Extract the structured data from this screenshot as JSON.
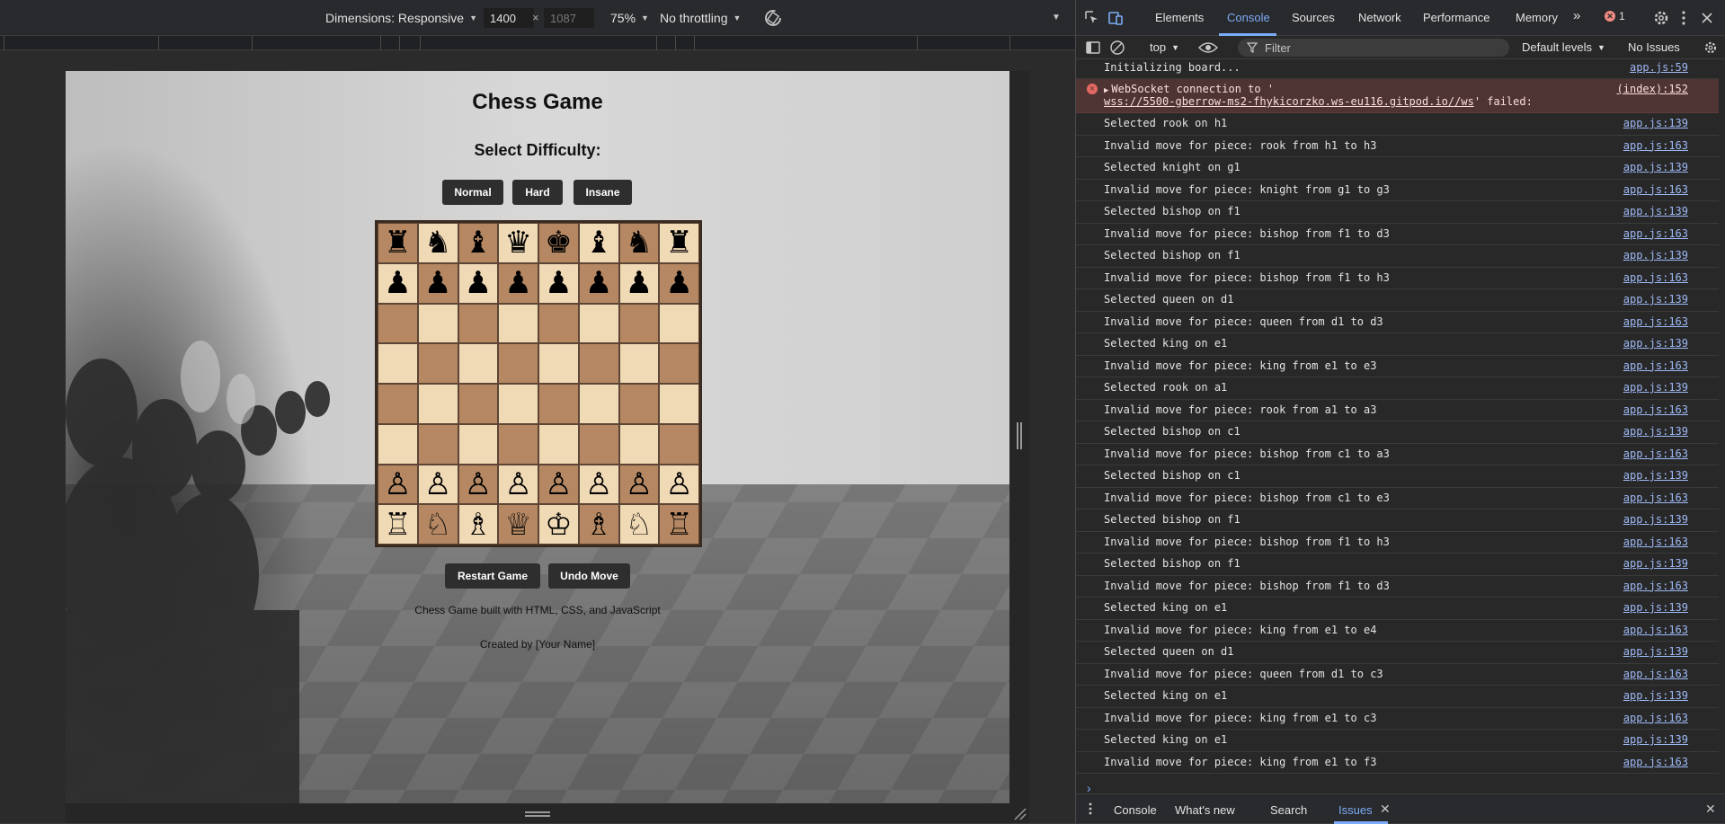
{
  "device_toolbar": {
    "dimensions_label": "Dimensions: Responsive",
    "width_value": "1400",
    "height_value": "1087",
    "x_separator": "×",
    "zoom": "75%",
    "throttling": "No throttling"
  },
  "page": {
    "title": "Chess Game",
    "difficulty_title": "Select Difficulty:",
    "difficulty_buttons": [
      "Normal",
      "Hard",
      "Insane"
    ],
    "board_rows": [
      [
        "♜",
        "♞",
        "♝",
        "♛",
        "♚",
        "♝",
        "♞",
        "♜"
      ],
      [
        "♟",
        "♟",
        "♟",
        "♟",
        "♟",
        "♟",
        "♟",
        "♟"
      ],
      [
        "",
        "",
        "",
        "",
        "",
        "",
        "",
        ""
      ],
      [
        "",
        "",
        "",
        "",
        "",
        "",
        "",
        ""
      ],
      [
        "",
        "",
        "",
        "",
        "",
        "",
        "",
        ""
      ],
      [
        "",
        "",
        "",
        "",
        "",
        "",
        "",
        ""
      ],
      [
        "♙",
        "♙",
        "♙",
        "♙",
        "♙",
        "♙",
        "♙",
        "♙"
      ],
      [
        "♖",
        "♘",
        "♗",
        "♕",
        "♔",
        "♗",
        "♘",
        "♖"
      ]
    ],
    "restart_label": "Restart Game",
    "undo_label": "Undo Move",
    "footer_line1": "Chess Game built with HTML, CSS, and JavaScript",
    "footer_line2": "Created by [Your Name]",
    "colors": {
      "light_square": "#f0d9b5",
      "dark_square": "#b58863",
      "button_bg": "#2e2e2e"
    }
  },
  "devtools": {
    "tabs": [
      "Elements",
      "Console",
      "Sources",
      "Network",
      "Performance",
      "Memory"
    ],
    "active_tab": "Console",
    "more_tabs_icon": "chevron-double-right-icon",
    "error_count": "1",
    "context": "top",
    "filter_placeholder": "Filter",
    "levels": "Default levels",
    "issues_status": "No Issues",
    "accent_color": "#7cacf8"
  },
  "console": {
    "first": {
      "text": "Initializing board...",
      "source": "app.js:59"
    },
    "error": {
      "prefix": "WebSocket connection to '",
      "url": "wss://5500-gberrow-ms2-fhykicorzko.ws-eu116.gitpod.io//ws",
      "suffix": "' failed:",
      "source": "(index):152"
    },
    "messages": [
      {
        "text": "Selected rook on h1",
        "source": "app.js:139"
      },
      {
        "text": "Invalid move for piece: rook from h1 to h3",
        "source": "app.js:163"
      },
      {
        "text": "Selected knight on g1",
        "source": "app.js:139"
      },
      {
        "text": "Invalid move for piece: knight from g1 to g3",
        "source": "app.js:163"
      },
      {
        "text": "Selected bishop on f1",
        "source": "app.js:139"
      },
      {
        "text": "Invalid move for piece: bishop from f1 to d3",
        "source": "app.js:163"
      },
      {
        "text": "Selected bishop on f1",
        "source": "app.js:139"
      },
      {
        "text": "Invalid move for piece: bishop from f1 to h3",
        "source": "app.js:163"
      },
      {
        "text": "Selected queen on d1",
        "source": "app.js:139"
      },
      {
        "text": "Invalid move for piece: queen from d1 to d3",
        "source": "app.js:163"
      },
      {
        "text": "Selected king on e1",
        "source": "app.js:139"
      },
      {
        "text": "Invalid move for piece: king from e1 to e3",
        "source": "app.js:163"
      },
      {
        "text": "Selected rook on a1",
        "source": "app.js:139"
      },
      {
        "text": "Invalid move for piece: rook from a1 to a3",
        "source": "app.js:163"
      },
      {
        "text": "Selected bishop on c1",
        "source": "app.js:139"
      },
      {
        "text": "Invalid move for piece: bishop from c1 to a3",
        "source": "app.js:163"
      },
      {
        "text": "Selected bishop on c1",
        "source": "app.js:139"
      },
      {
        "text": "Invalid move for piece: bishop from c1 to e3",
        "source": "app.js:163"
      },
      {
        "text": "Selected bishop on f1",
        "source": "app.js:139"
      },
      {
        "text": "Invalid move for piece: bishop from f1 to h3",
        "source": "app.js:163"
      },
      {
        "text": "Selected bishop on f1",
        "source": "app.js:139"
      },
      {
        "text": "Invalid move for piece: bishop from f1 to d3",
        "source": "app.js:163"
      },
      {
        "text": "Selected king on e1",
        "source": "app.js:139"
      },
      {
        "text": "Invalid move for piece: king from e1 to e4",
        "source": "app.js:163"
      },
      {
        "text": "Selected queen on d1",
        "source": "app.js:139"
      },
      {
        "text": "Invalid move for piece: queen from d1 to c3",
        "source": "app.js:163"
      },
      {
        "text": "Selected king on e1",
        "source": "app.js:139"
      },
      {
        "text": "Invalid move for piece: king from e1 to c3",
        "source": "app.js:163"
      },
      {
        "text": "Selected king on e1",
        "source": "app.js:139"
      },
      {
        "text": "Invalid move for piece: king from e1 to f3",
        "source": "app.js:163"
      }
    ],
    "prompt": "›"
  },
  "drawer": {
    "tabs": [
      "Console",
      "What's new",
      "Search",
      "Issues"
    ],
    "active_tab": "Issues"
  }
}
